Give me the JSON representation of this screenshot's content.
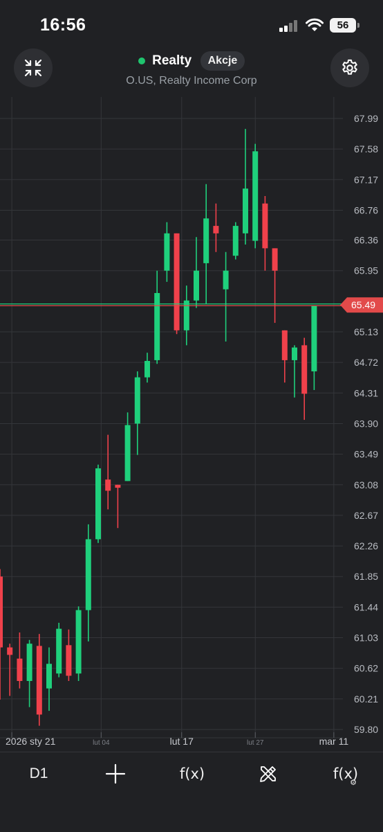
{
  "status_bar": {
    "time": "16:56",
    "battery": "56"
  },
  "header": {
    "symbol": "Realty",
    "type_badge": "Akcje",
    "subtitle": "O.US, Realty Income Corp"
  },
  "chart_data": {
    "type": "candlestick",
    "title": "",
    "price_ticks": [
      "67.99",
      "67.58",
      "67.17",
      "66.76",
      "66.36",
      "65.95",
      "65.13",
      "64.72",
      "64.31",
      "63.90",
      "63.49",
      "63.08",
      "62.67",
      "62.26",
      "61.85",
      "61.44",
      "61.03",
      "60.62",
      "60.21",
      "59.80"
    ],
    "current_price": "65.49",
    "current_price_value": 65.49,
    "ylim": [
      59.8,
      67.99
    ],
    "date_labels": [
      {
        "text": "2026 sty 21",
        "index": 0.5,
        "major": true
      },
      {
        "text": "lut 04",
        "index": 9.6,
        "major": false
      },
      {
        "text": "lut 17",
        "index": 17.8,
        "major": true
      },
      {
        "text": "lut 27",
        "index": 25.3,
        "major": false
      },
      {
        "text": "mar 11",
        "index": 33.3,
        "major": true
      }
    ],
    "candles": [
      {
        "o": 61.85,
        "h": 61.95,
        "l": 60.2,
        "c": 60.9
      },
      {
        "o": 60.9,
        "h": 60.95,
        "l": 60.25,
        "c": 60.8
      },
      {
        "o": 60.75,
        "h": 61.1,
        "l": 60.35,
        "c": 60.45
      },
      {
        "o": 60.45,
        "h": 61.0,
        "l": 60.1,
        "c": 60.95
      },
      {
        "o": 60.92,
        "h": 61.08,
        "l": 59.85,
        "c": 60.0
      },
      {
        "o": 60.35,
        "h": 60.9,
        "l": 60.05,
        "c": 60.68
      },
      {
        "o": 60.55,
        "h": 61.23,
        "l": 60.5,
        "c": 61.15
      },
      {
        "o": 60.93,
        "h": 61.14,
        "l": 60.45,
        "c": 60.52
      },
      {
        "o": 60.55,
        "h": 61.45,
        "l": 60.45,
        "c": 61.4
      },
      {
        "o": 61.4,
        "h": 62.55,
        "l": 60.98,
        "c": 62.35
      },
      {
        "o": 62.35,
        "h": 63.35,
        "l": 62.3,
        "c": 63.3
      },
      {
        "o": 63.15,
        "h": 63.75,
        "l": 62.75,
        "c": 63.0
      },
      {
        "o": 63.08,
        "h": 63.08,
        "l": 62.5,
        "c": 63.04
      },
      {
        "o": 63.13,
        "h": 64.05,
        "l": 63.13,
        "c": 63.88
      },
      {
        "o": 63.9,
        "h": 64.6,
        "l": 63.48,
        "c": 64.52
      },
      {
        "o": 64.52,
        "h": 64.85,
        "l": 64.45,
        "c": 64.74
      },
      {
        "o": 64.75,
        "h": 65.95,
        "l": 64.7,
        "c": 65.65
      },
      {
        "o": 65.95,
        "h": 66.6,
        "l": 65.8,
        "c": 66.45
      },
      {
        "o": 66.45,
        "h": 66.45,
        "l": 65.1,
        "c": 65.15
      },
      {
        "o": 65.15,
        "h": 65.75,
        "l": 64.95,
        "c": 65.55
      },
      {
        "o": 65.55,
        "h": 66.4,
        "l": 65.45,
        "c": 65.95
      },
      {
        "o": 66.05,
        "h": 67.11,
        "l": 65.5,
        "c": 66.65
      },
      {
        "o": 66.55,
        "h": 66.85,
        "l": 66.2,
        "c": 66.45
      },
      {
        "o": 65.7,
        "h": 66.2,
        "l": 65.0,
        "c": 65.95
      },
      {
        "o": 66.15,
        "h": 66.6,
        "l": 66.1,
        "c": 66.55
      },
      {
        "o": 66.45,
        "h": 67.85,
        "l": 66.3,
        "c": 67.05
      },
      {
        "o": 66.35,
        "h": 67.65,
        "l": 66.25,
        "c": 67.55
      },
      {
        "o": 66.85,
        "h": 66.95,
        "l": 65.95,
        "c": 66.25
      },
      {
        "o": 66.25,
        "h": 66.25,
        "l": 65.25,
        "c": 65.95
      },
      {
        "o": 65.15,
        "h": 65.15,
        "l": 64.45,
        "c": 64.75
      },
      {
        "o": 64.75,
        "h": 64.95,
        "l": 64.25,
        "c": 64.92
      },
      {
        "o": 64.95,
        "h": 65.05,
        "l": 63.95,
        "c": 64.3
      },
      {
        "o": 64.6,
        "h": 65.48,
        "l": 64.35,
        "c": 65.48
      }
    ],
    "colors": {
      "up": "#1fd07c",
      "down": "#f0414b",
      "price_line": "#e24a4a",
      "price_line_alt": "#1fd07c",
      "grid": "#34363a"
    }
  },
  "toolbar": {
    "timeframe": "D1",
    "plus_icon": "crosshair-icon",
    "indicators": "f(x)",
    "draw_icon": "drawing-tools-icon",
    "indicator_settings": "f(x)"
  }
}
